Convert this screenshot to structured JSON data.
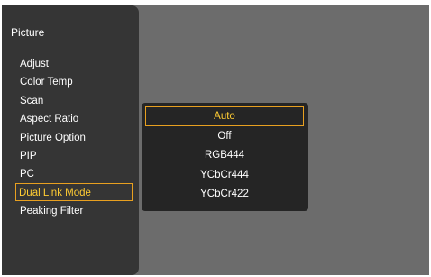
{
  "menu": {
    "title": "Picture",
    "items": [
      {
        "label": "Adjust"
      },
      {
        "label": "Color Temp"
      },
      {
        "label": "Scan"
      },
      {
        "label": "Aspect Ratio"
      },
      {
        "label": "Picture Option"
      },
      {
        "label": "PIP"
      },
      {
        "label": "PC"
      },
      {
        "label": "Dual Link Mode"
      },
      {
        "label": "Peaking Filter"
      }
    ],
    "selected_item": "Dual Link Mode"
  },
  "popup": {
    "options": [
      {
        "label": "Auto"
      },
      {
        "label": "Off"
      },
      {
        "label": "RGB444"
      },
      {
        "label": "YCbCr444"
      },
      {
        "label": "YCbCr422"
      }
    ],
    "selected_option": "Auto"
  },
  "colors": {
    "background": "#6c6c6c",
    "panel": "#353535",
    "popup": "#252525",
    "highlight_text": "#ffcc33",
    "highlight_border": "#e8a020"
  }
}
